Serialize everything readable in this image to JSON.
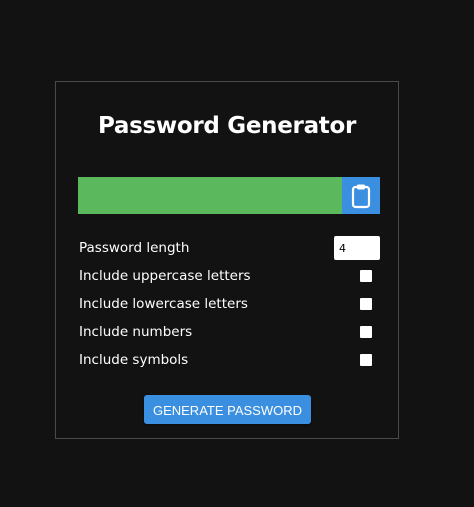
{
  "app": {
    "title": "Password Generator"
  },
  "result": {
    "password": "",
    "clipboard_icon": "clipboard-icon"
  },
  "settings": {
    "length_label": "Password length",
    "length_value": "4",
    "uppercase_label": "Include uppercase letters",
    "uppercase_checked": false,
    "lowercase_label": "Include lowercase letters",
    "lowercase_checked": false,
    "numbers_label": "Include numbers",
    "numbers_checked": false,
    "symbols_label": "Include symbols",
    "symbols_checked": false
  },
  "actions": {
    "generate_label": "GENERATE PASSWORD"
  },
  "colors": {
    "background": "#121212",
    "card_border": "#4a4a4a",
    "result_bg": "#5cb85c",
    "accent": "#3b8fe0",
    "text": "#ffffff"
  }
}
